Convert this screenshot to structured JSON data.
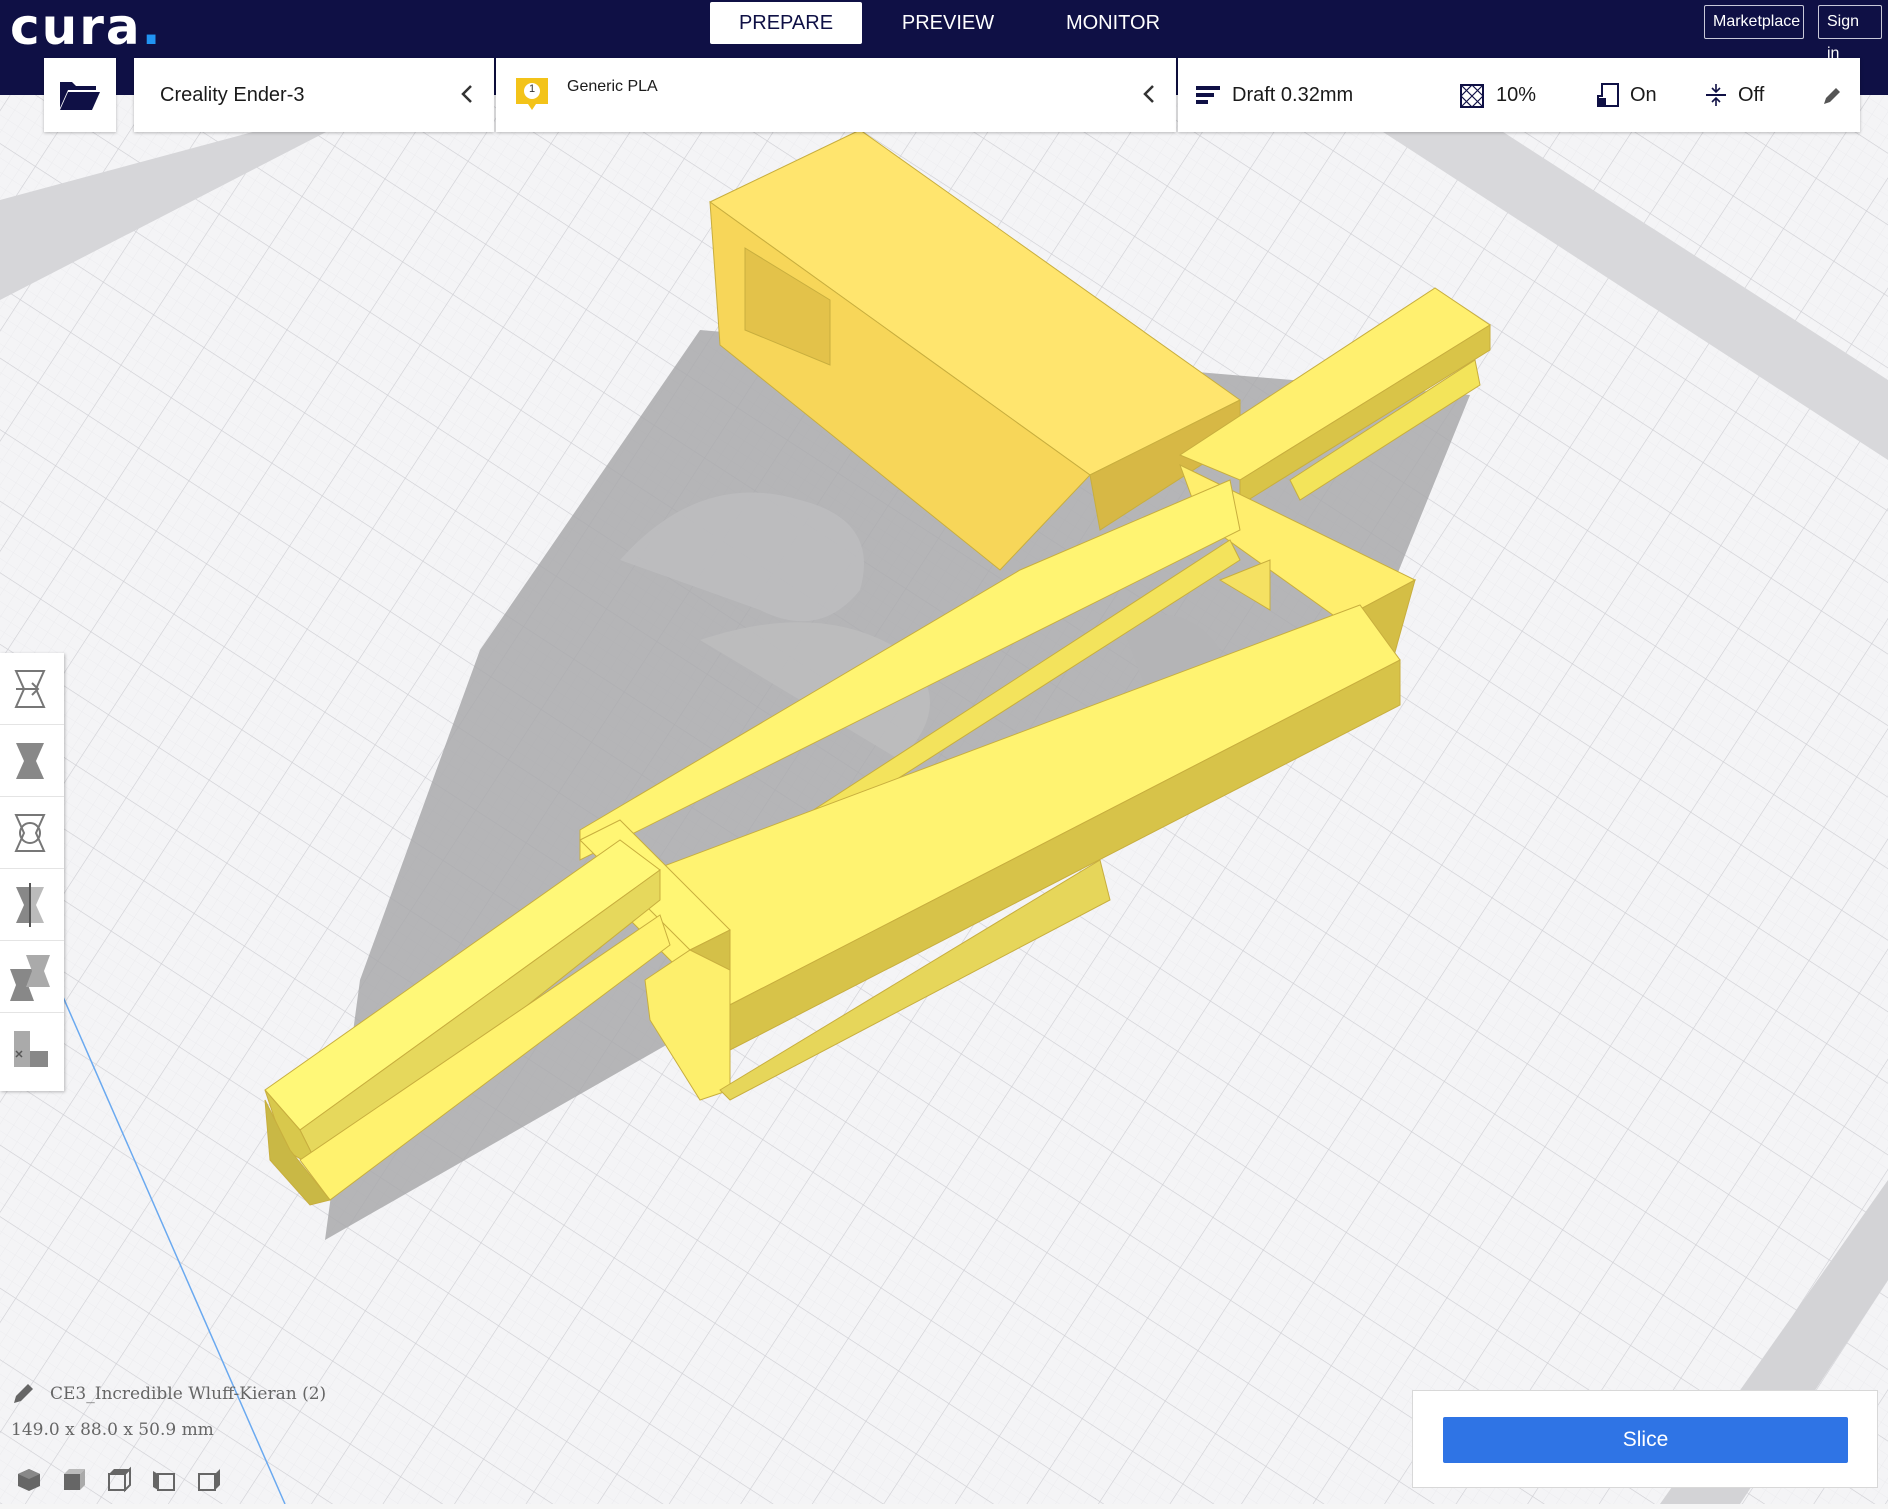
{
  "app": {
    "logo_text": "cura",
    "logo_dot": "."
  },
  "header": {
    "tabs": [
      {
        "label": "PREPARE",
        "active": true
      },
      {
        "label": "PREVIEW",
        "active": false
      },
      {
        "label": "MONITOR",
        "active": false
      }
    ],
    "marketplace_label": "Marketplace",
    "sign_in_label": "Sign in"
  },
  "toolbar": {
    "open_file_icon": "folder-open-icon",
    "printer": {
      "name": "Creality Ender-3"
    },
    "material": {
      "extruder_number": "1",
      "name": "Generic PLA"
    },
    "settings": {
      "profile": "Draft 0.32mm",
      "infill": "10%",
      "support": "On",
      "adhesion": "Off",
      "edit_icon": "pencil-icon"
    }
  },
  "left_toolbar": {
    "tools": [
      "move-tool-icon",
      "scale-tool-icon",
      "rotate-tool-icon",
      "mirror-tool-icon",
      "per-model-settings-icon",
      "support-blocker-icon"
    ]
  },
  "object_info": {
    "name": "CE3_Incredible Wluff-Kieran (2)",
    "dimensions": "149.0 x 88.0 x 50.9 mm"
  },
  "view_buttons": [
    "3d-view-icon",
    "front-view-icon",
    "top-view-icon",
    "left-view-icon",
    "right-view-icon"
  ],
  "slice": {
    "button_label": "Slice"
  },
  "colors": {
    "header_bg": "#0f1045",
    "accent_blue": "#2f74e5",
    "model_yellow": "#ffe36a",
    "model_shadow": "#a8a8a8"
  }
}
